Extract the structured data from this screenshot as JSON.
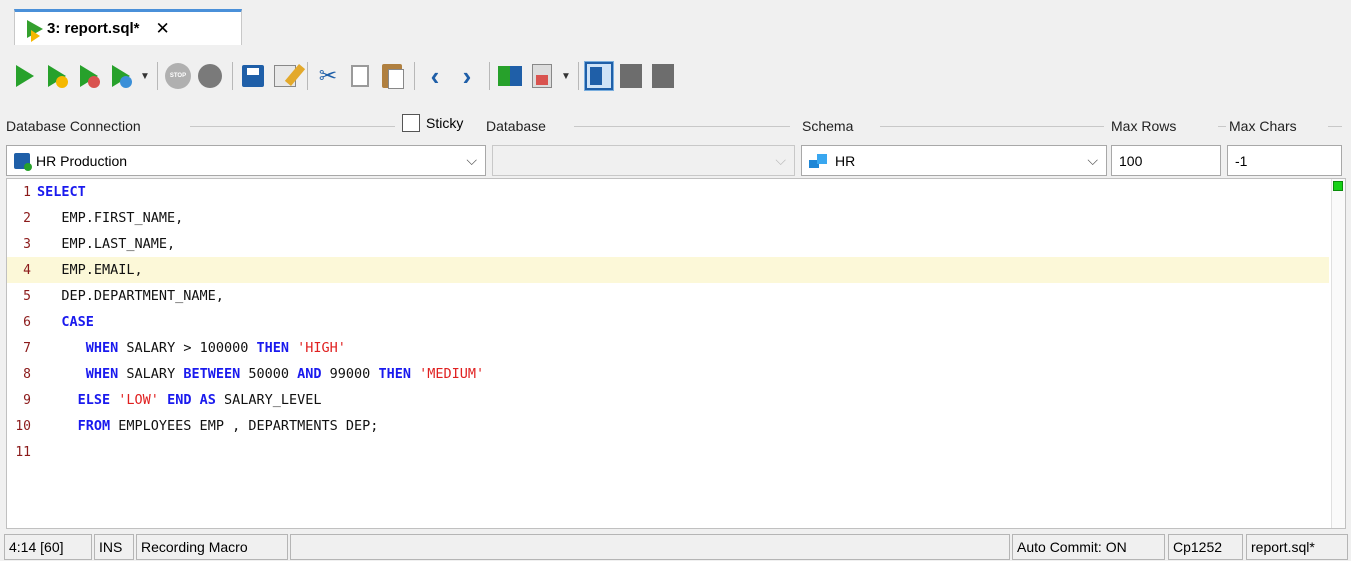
{
  "tab": {
    "title": "3: report.sql*",
    "close": "✕"
  },
  "toolbar": {
    "stop_label": "STOP"
  },
  "labels": {
    "db_connection": "Database Connection",
    "sticky": "Sticky",
    "database": "Database",
    "schema": "Schema",
    "max_rows": "Max Rows",
    "max_chars": "Max Chars"
  },
  "fields": {
    "db_connection_value": "HR Production",
    "database_value": "",
    "schema_value": "HR",
    "max_rows_value": "100",
    "max_chars_value": "-1"
  },
  "editor": {
    "line_numbers": [
      "1",
      "2",
      "3",
      "4",
      "5",
      "6",
      "7",
      "8",
      "9",
      "10",
      "11"
    ],
    "tokens": {
      "l1_kw": "SELECT",
      "l2": "   EMP.FIRST_NAME,",
      "l3": "   EMP.LAST_NAME,",
      "l4": "   EMP.EMAIL,",
      "l5": "   DEP.DEPARTMENT_NAME,",
      "l6_kw": "CASE",
      "l7_kw1": "WHEN",
      "l7_mid": " SALARY > 100000 ",
      "l7_kw2": "THEN",
      "l7_str": "'HIGH'",
      "l8_kw1": "WHEN",
      "l8_mid1": " SALARY ",
      "l8_kw2": "BETWEEN",
      "l8_mid2": " 50000 ",
      "l8_kw3": "AND",
      "l8_mid3": " 99000 ",
      "l8_kw4": "THEN",
      "l8_str": "'MEDIUM'",
      "l9_kw1": "ELSE",
      "l9_str": "'LOW'",
      "l9_kw2": "END AS",
      "l9_rest": " SALARY_LEVEL",
      "l10_kw": "FROM",
      "l10_rest": " EMPLOYEES EMP , DEPARTMENTS DEP;"
    }
  },
  "status": {
    "position": "4:14 [60]",
    "mode": "INS",
    "macro": "Recording Macro",
    "autocommit": "Auto Commit: ON",
    "encoding": "Cp1252",
    "file": "report.sql*"
  },
  "colors": {
    "keyword": "#1a1aee",
    "string": "#e02020",
    "line_number": "#8b1a1a",
    "current_line": "#fcf8d8",
    "accent": "#4a90d9"
  }
}
